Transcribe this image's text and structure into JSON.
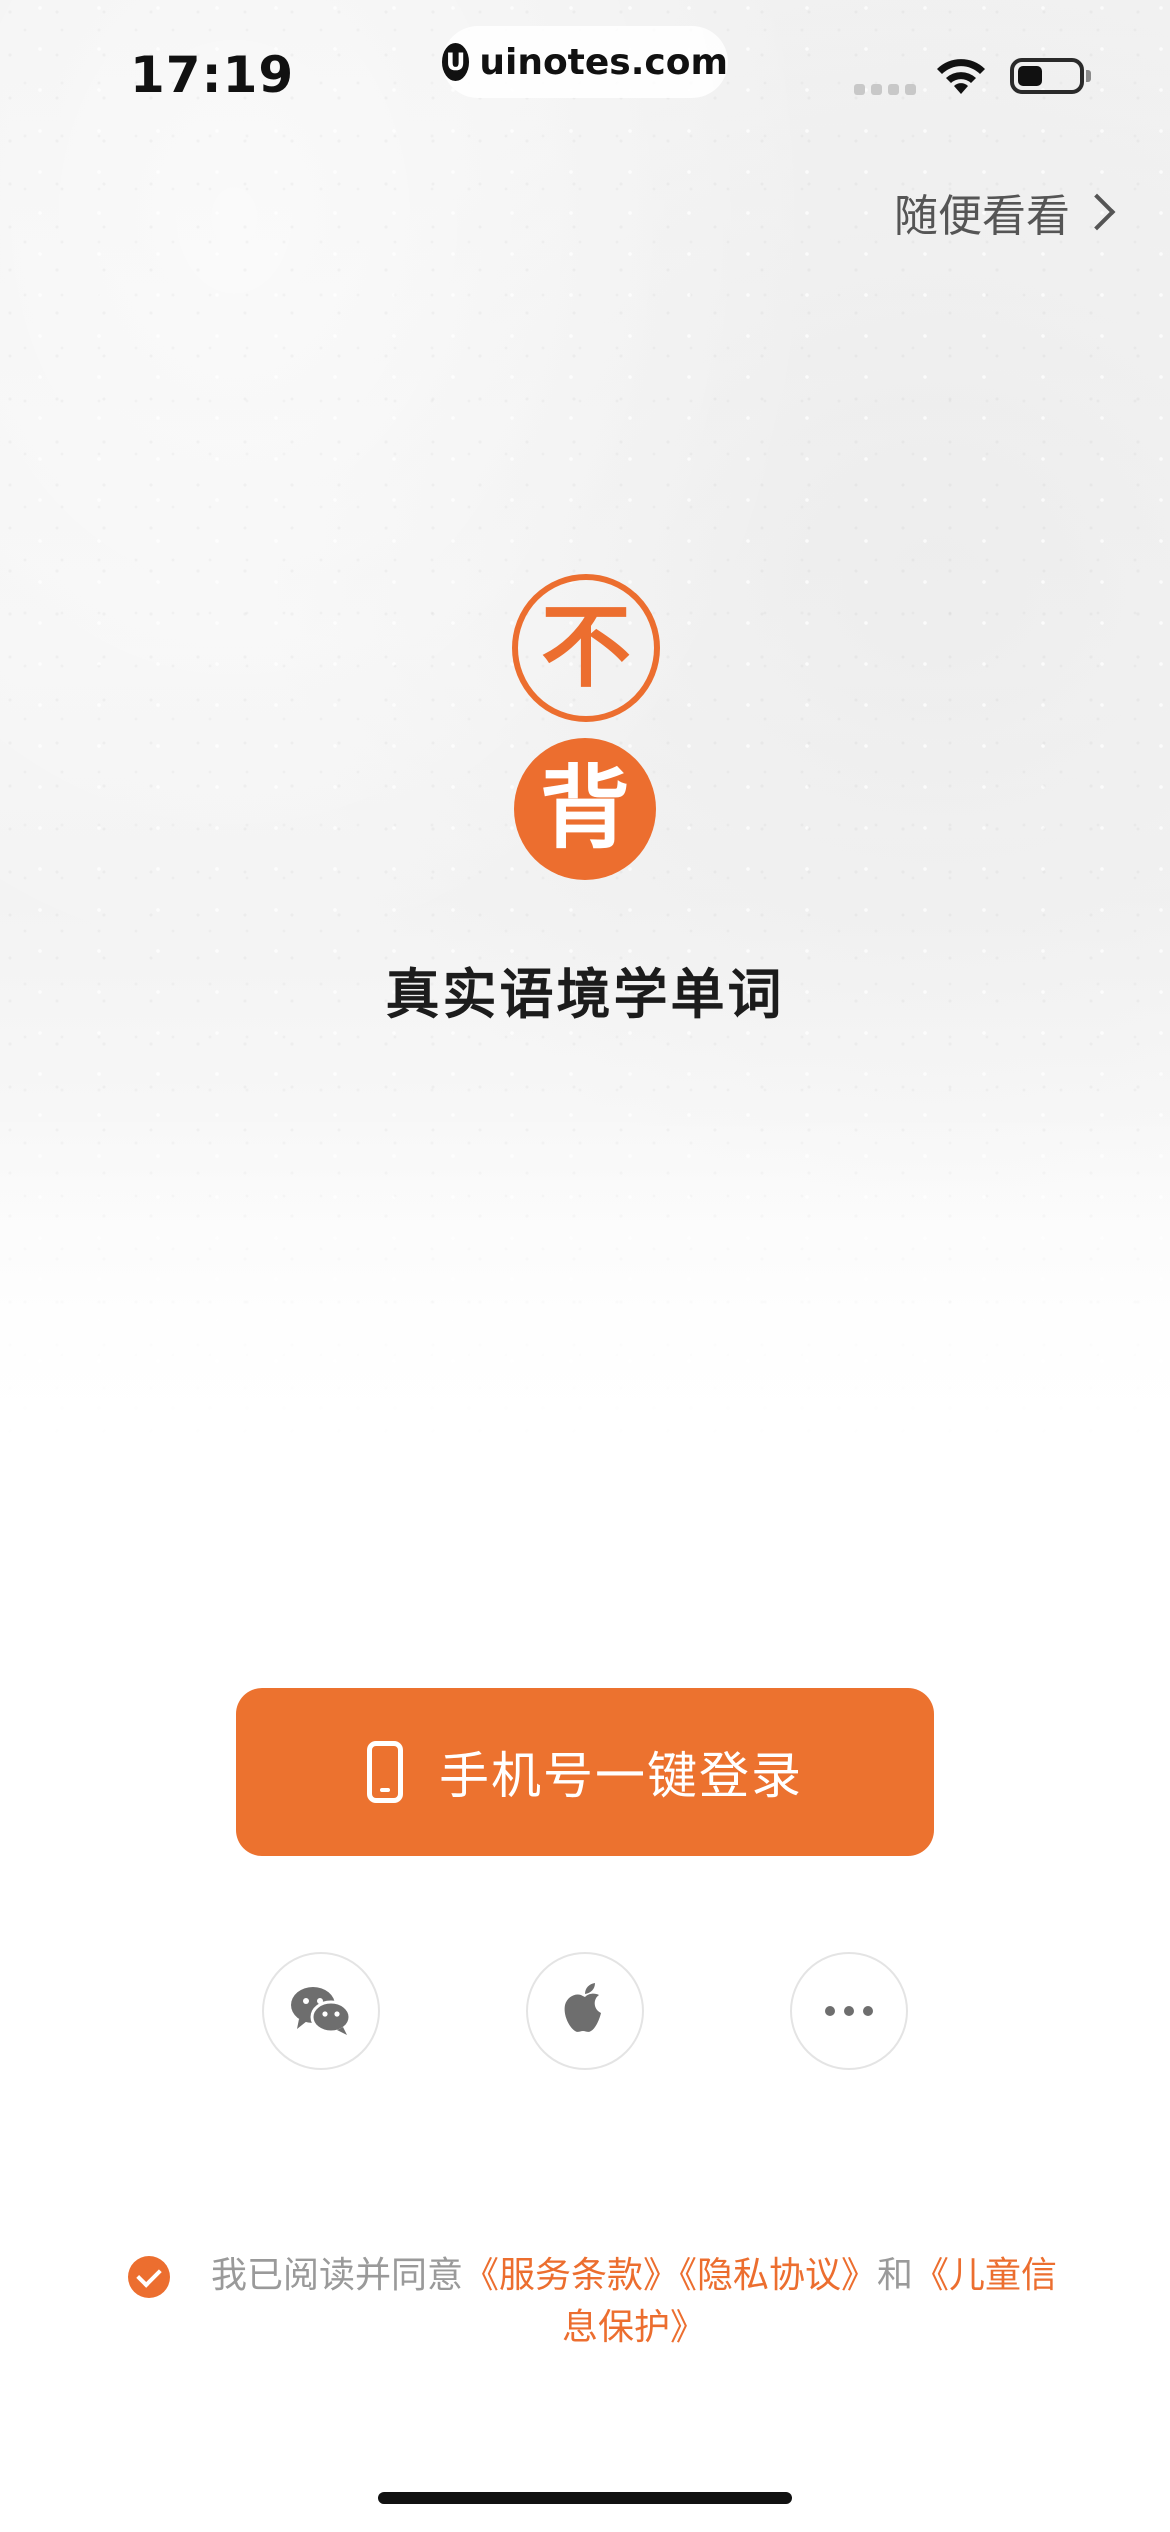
{
  "status_bar": {
    "time": "17:19",
    "url": "uinotes.com",
    "url_logo": "U"
  },
  "browse_link": {
    "label": "随便看看"
  },
  "logo": {
    "top_char": "不",
    "bottom_char": "背"
  },
  "tagline": "真实语境学单词",
  "login_button": {
    "label": "手机号一键登录",
    "icon": "phone-icon"
  },
  "social_login": [
    {
      "name": "wechat",
      "icon": "wechat-icon"
    },
    {
      "name": "apple",
      "icon": "apple-icon"
    },
    {
      "name": "more",
      "icon": "more-icon"
    }
  ],
  "agreement": {
    "checked": true,
    "prefix": "我已阅读并同意",
    "terms_link": "《服务条款》",
    "privacy_link": "《隐私协议》",
    "and": "和",
    "children_link": "《儿童信息保护》"
  },
  "colors": {
    "accent": "#ec6e2f",
    "text_dark": "#1c1c1c",
    "text_muted": "#9a9a9a"
  }
}
